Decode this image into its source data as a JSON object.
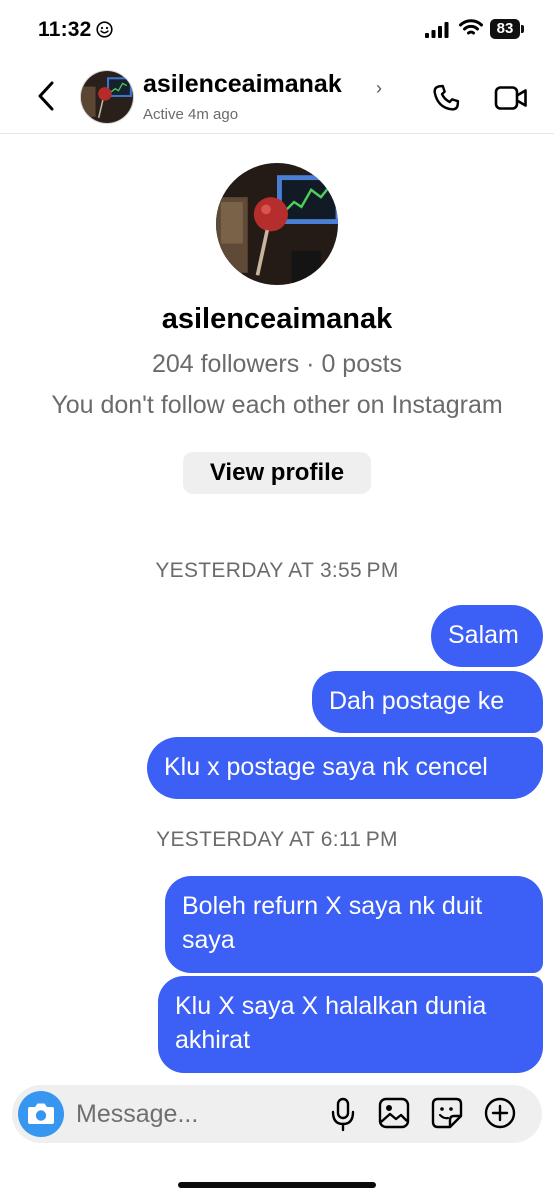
{
  "status_bar": {
    "time": "11:32",
    "battery": "83"
  },
  "header": {
    "username": "asilenceaimanak",
    "activity": "Active 4m ago"
  },
  "profile": {
    "username": "asilenceaimanak",
    "stats": "204 followers · 0 posts",
    "relationship": "You don't follow each other on Instagram",
    "view_profile_label": "View profile"
  },
  "messages": {
    "timestamp_1": "YESTERDAY AT 3:55 PM",
    "m1": "Salam",
    "m2": "Dah postage ke",
    "m3": "Klu x postage saya nk cencel",
    "timestamp_2": "YESTERDAY AT 6:11 PM",
    "m4": "Boleh refurn X saya nk duit saya",
    "m5": "Klu X saya X halalkan dunia akhirat"
  },
  "composer": {
    "placeholder": "Message..."
  },
  "colors": {
    "bubble": "#3c5ff5",
    "camera_button": "#3797f0",
    "secondary_text": "#6b6b6b"
  },
  "icons": [
    "back-chevron-icon",
    "phone-icon",
    "video-camera-icon",
    "camera-icon",
    "microphone-icon",
    "gallery-icon",
    "sticker-icon",
    "plus-icon"
  ]
}
